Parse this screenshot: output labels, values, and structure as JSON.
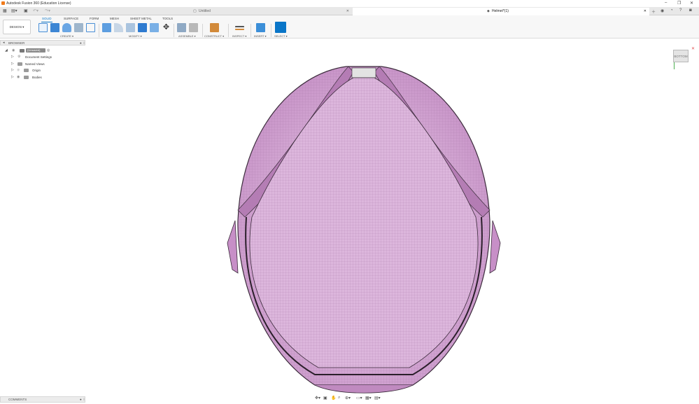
{
  "window": {
    "title": "Autodesk Fusion 360 (Education License)",
    "controls": [
      "–",
      "❐",
      "✕"
    ]
  },
  "tabs": [
    {
      "label": "Untitled",
      "active": false
    },
    {
      "label": "Helmet*(1)",
      "active": true
    }
  ],
  "toolbar": {
    "workspace_button": "DESIGN ▾",
    "workspace_tabs": [
      "SOLID",
      "SURFACE",
      "FORM",
      "MESH",
      "SHEET METAL",
      "TOOLS"
    ],
    "active_tab": "SOLID",
    "groups": [
      "CREATE ▾",
      "MODIFY ▾",
      "ASSEMBLE ▾",
      "CONSTRUCT ▾",
      "INSPECT ▾",
      "INSERT ▾",
      "SELECT ▾"
    ]
  },
  "browser": {
    "header": "BROWSER",
    "root": "(Unsaved)",
    "items": [
      {
        "label": "Document Settings",
        "icon": "gear-icon"
      },
      {
        "label": "Named Views",
        "icon": "folder-icon"
      },
      {
        "label": "Origin",
        "icon": "folder-icon"
      },
      {
        "label": "Bodies",
        "icon": "folder-icon"
      }
    ]
  },
  "viewcube": {
    "face": "BOTTOM"
  },
  "comments": {
    "label": "COMMENTS"
  },
  "colors": {
    "accent": "#0a76c8",
    "body_fill": "#d9a8d9",
    "body_edge": "#3a2a3a"
  }
}
